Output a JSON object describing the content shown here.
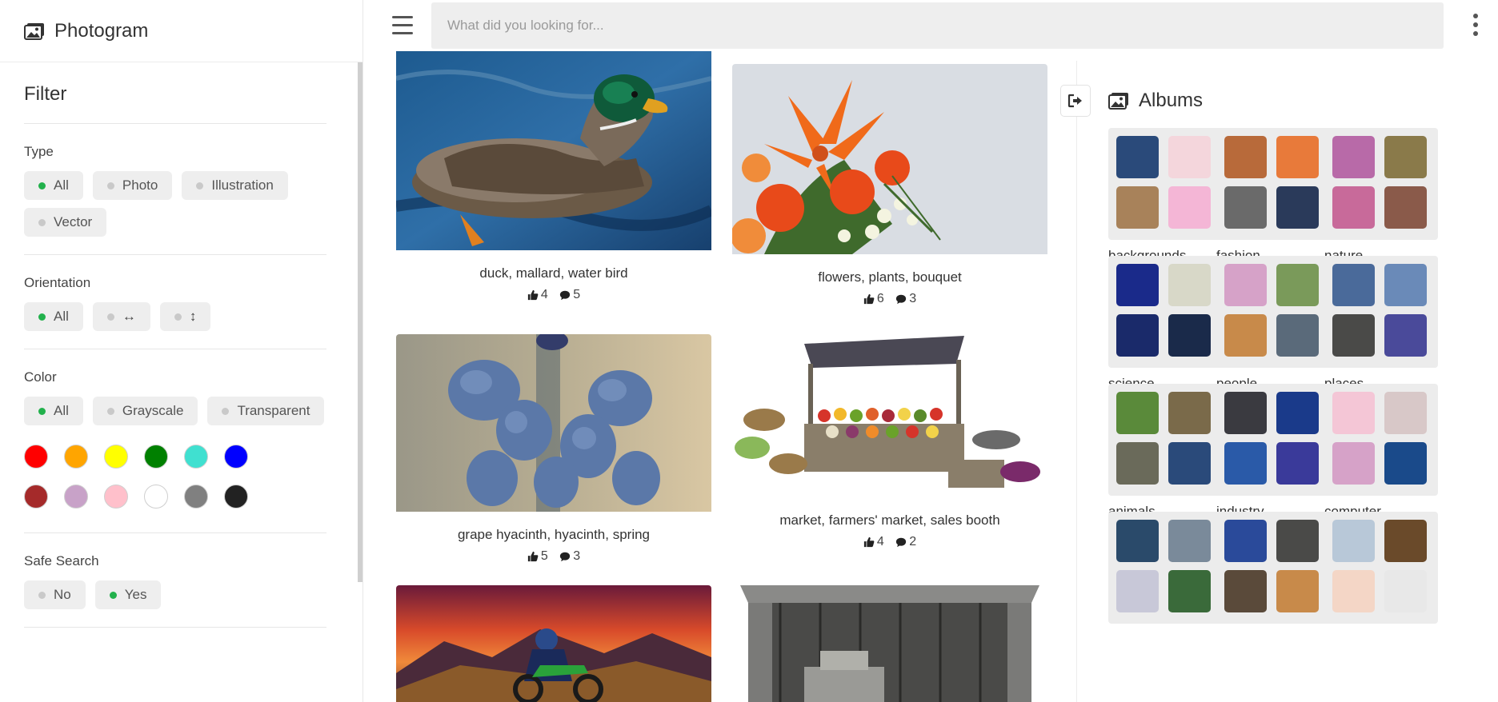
{
  "app": {
    "title": "Photogram"
  },
  "search": {
    "placeholder": "What did you looking for..."
  },
  "filter": {
    "title": "Filter",
    "type": {
      "title": "Type",
      "options": [
        "All",
        "Photo",
        "Illustration",
        "Vector"
      ],
      "selected": "All"
    },
    "orientation": {
      "title": "Orientation",
      "options": [
        "All",
        "↔",
        "↕"
      ],
      "selected": "All"
    },
    "color": {
      "title": "Color",
      "options": [
        "All",
        "Grayscale",
        "Transparent"
      ],
      "selected": "All",
      "swatches": [
        "#ff0000",
        "#ffa500",
        "#ffff00",
        "#008000",
        "#40e0d0",
        "#0000ff",
        "#a52a2a",
        "#c8a2c8",
        "#ffc0cb",
        "#ffffff",
        "#808080",
        "#222222"
      ]
    },
    "safe_search": {
      "title": "Safe Search",
      "options": [
        "No",
        "Yes"
      ],
      "selected": "Yes"
    }
  },
  "feed": [
    {
      "caption": "duck, mallard, water bird",
      "likes": "4",
      "comments": "5"
    },
    {
      "caption": "flowers, plants, bouquet",
      "likes": "6",
      "comments": "3"
    },
    {
      "caption": "grape hyacinth, hyacinth, spring",
      "likes": "5",
      "comments": "3"
    },
    {
      "caption": "market, farmers' market, sales booth",
      "likes": "4",
      "comments": "2"
    }
  ],
  "albums": {
    "title": "Albums",
    "items": [
      {
        "name": "backgrounds..."
      },
      {
        "name": "fashion..."
      },
      {
        "name": "nature..."
      },
      {
        "name": "science..."
      },
      {
        "name": "people..."
      },
      {
        "name": "places..."
      },
      {
        "name": "animals..."
      },
      {
        "name": "industry..."
      },
      {
        "name": "computer..."
      },
      {
        "name": ""
      },
      {
        "name": ""
      },
      {
        "name": ""
      }
    ]
  },
  "colors": {
    "active_dot": "#22b14c",
    "chip_bg": "#eeeeee"
  }
}
